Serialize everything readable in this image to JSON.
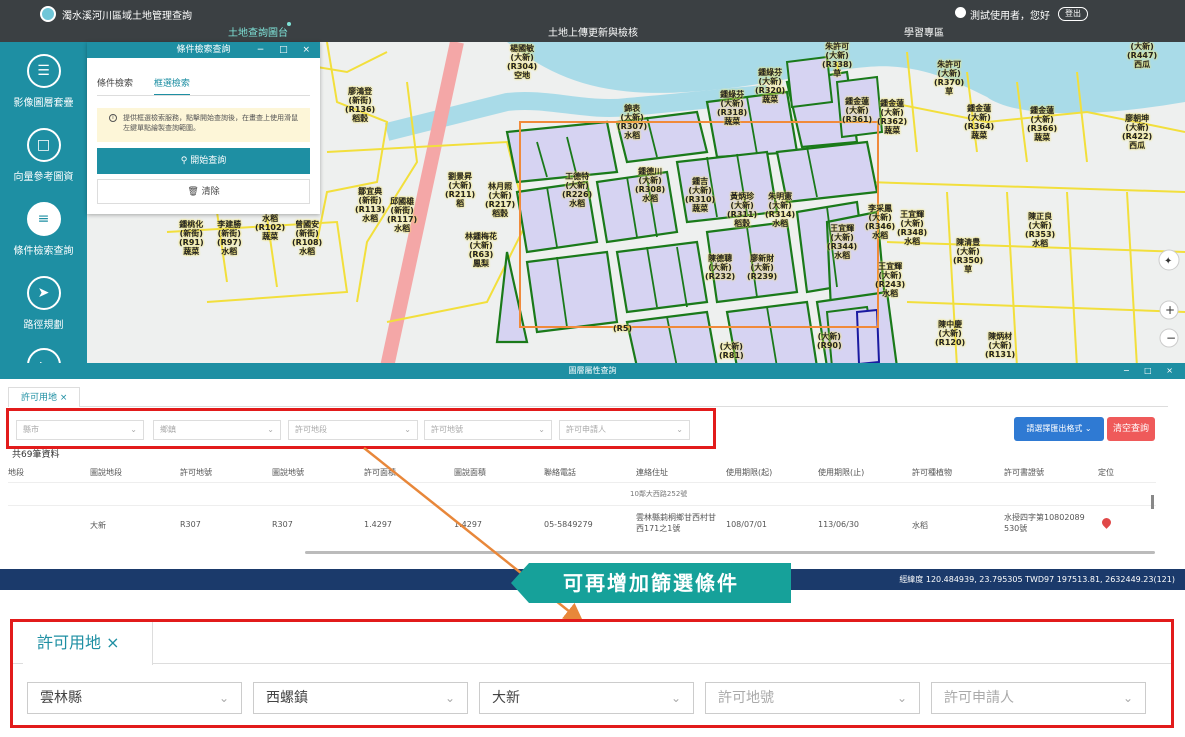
{
  "topbar": {
    "app_title": "濁水溪河川區域土地管理查詢",
    "nav": [
      "土地查詢圖台",
      "土地上傳更新與檢核",
      "學習專區"
    ],
    "user": "測試使用者，您好",
    "logout": "登出"
  },
  "sidebar": [
    {
      "label": "影像圖層套疊",
      "icon": "layers-icon"
    },
    {
      "label": "向量參考圖資",
      "icon": "file-icon"
    },
    {
      "label": "條件檢索查詢",
      "icon": "filter-search-icon"
    },
    {
      "label": "路徑規劃",
      "icon": "route-icon"
    }
  ],
  "filter_panel": {
    "title": "條件檢索查詢",
    "tabs": [
      "條件檢索",
      "框選檢索"
    ],
    "active_tab": 1,
    "info": "提供框選檢索服務，點擊開始查詢後，在畫查上使用滑鼠左鍵單點繪製查詢範圍。",
    "start_button": "開始查詢",
    "clear_button": "清除"
  },
  "map": {
    "labels": [
      "楊國敏\n(大新)\n(R304)\n空地",
      "鍾綠芬\n(大新)\n(R320)\n蔬菜",
      "朱許可\n(大新)\n(R338)\n草",
      "朱許可\n(大新)\n(R370)\n草",
      "(大新)\n(R447)\n西瓜",
      "廖鴻登\n(新街)\n(R136)\n稻穀",
      "鍾綠芬\n(大新)\n(R318)\n蔬菜",
      "錦表\n(大新)\n(R307)\n水稻",
      "鍾金蓮\n(大新)\n(R361)",
      "鍾金蓮\n(大新)\n(R362)\n蔬菜",
      "鍾金蓮\n(大新)\n(R364)\n蔬菜",
      "鍾金蓮\n(大新)\n(R366)\n蔬菜",
      "廖朝坤\n(大新)\n(R422)\n西瓜",
      "鍾德川\n(大新)\n(R308)\n水稻",
      "工德特\n(大新)\n(R226)\n水稻",
      "劉景昇\n(大新)\n(R211)\n稻",
      "林月照\n(大新)\n(R217)\n稻穀",
      "鍾吉\n(大新)\n(R310)\n蔬菜",
      "黃炳珍\n(大新)\n(R311)\n稻穀",
      "朱明憲\n(大新)\n(R314)\n水稻",
      "鄒宜典\n(新街)\n(R113)\n水稻",
      "邱國雄\n(新街)\n(R117)\n水稻",
      "鍾桃化\n(新街)\n(R91)\n蔬菜",
      "李建勝\n(新街)\n(R97)\n水稻",
      "水稻\n(R102)\n蔬菜",
      "曾國安\n(新街)\n(R108)\n水稻",
      "林鍾梅花\n(大新)\n(R63)\n鳳梨",
      "陳德聰\n(大新)\n(R232)",
      "廖新財\n(大新)\n(R239)",
      "王宜輝\n(大新)\n(R344)\n水稻",
      "李采鳳\n(大新)\n(R346)\n水稻",
      "王宜輝\n(大新)\n(R348)\n水稻",
      "陳正良\n(大新)\n(R353)\n水稻",
      "陳清豊\n(大新)\n(R350)\n草",
      "王宜輝\n(大新)\n(R243)\n水稻",
      "陳中慶\n(大新)\n(R120)",
      "陳炳材\n(大新)\n(R131)",
      "(大新)\n(R90)",
      "(大新)\n(R81)",
      "(R5)"
    ]
  },
  "attr_panel": {
    "title": "圖層屬性查詢",
    "tab": "許可用地",
    "filters": [
      "縣市",
      "鄉鎮",
      "許可地段",
      "許可地號",
      "許可申請人"
    ],
    "export_button": "請選擇匯出格式",
    "clear_button": "清空查詢",
    "count": "共69筆資料",
    "columns": [
      "地段",
      "圖說地段",
      "許可地號",
      "圖說地號",
      "許可面積",
      "圖說面積",
      "聯絡電話",
      "連絡住址",
      "使用期限(起)",
      "使用期限(止)",
      "許可種植物",
      "許可書證號",
      "定位"
    ],
    "cutoff_text": "10鄰大西路252號",
    "rows": [
      [
        "",
        "大新",
        "R307",
        "R307",
        "1.4297",
        "1.4297",
        "05-5849279",
        "雲林縣莿桐鄉甘西村甘西171之1號",
        "108/07/01",
        "113/06/30",
        "水稻",
        "水授四字第10802089530號",
        ""
      ]
    ]
  },
  "statusbar": "經緯度 120.484939, 23.795305 TWD97 197513.81, 2632449.23(121)",
  "callout": "可再增加篩選條件",
  "zoom": {
    "tab": "許可用地 ×",
    "filters": [
      {
        "value": "雲林縣",
        "placeholder": false
      },
      {
        "value": "西螺鎮",
        "placeholder": false
      },
      {
        "value": "大新",
        "placeholder": false
      },
      {
        "value": "許可地號",
        "placeholder": true
      },
      {
        "value": "許可申請人",
        "placeholder": true
      }
    ]
  },
  "colors": {
    "teal": "#1e8fa3",
    "highlight": "#e21b1b",
    "callout": "#16a19a",
    "parcel_border": "#1a7a1a",
    "parcel_fill": "#d6d3f2"
  }
}
